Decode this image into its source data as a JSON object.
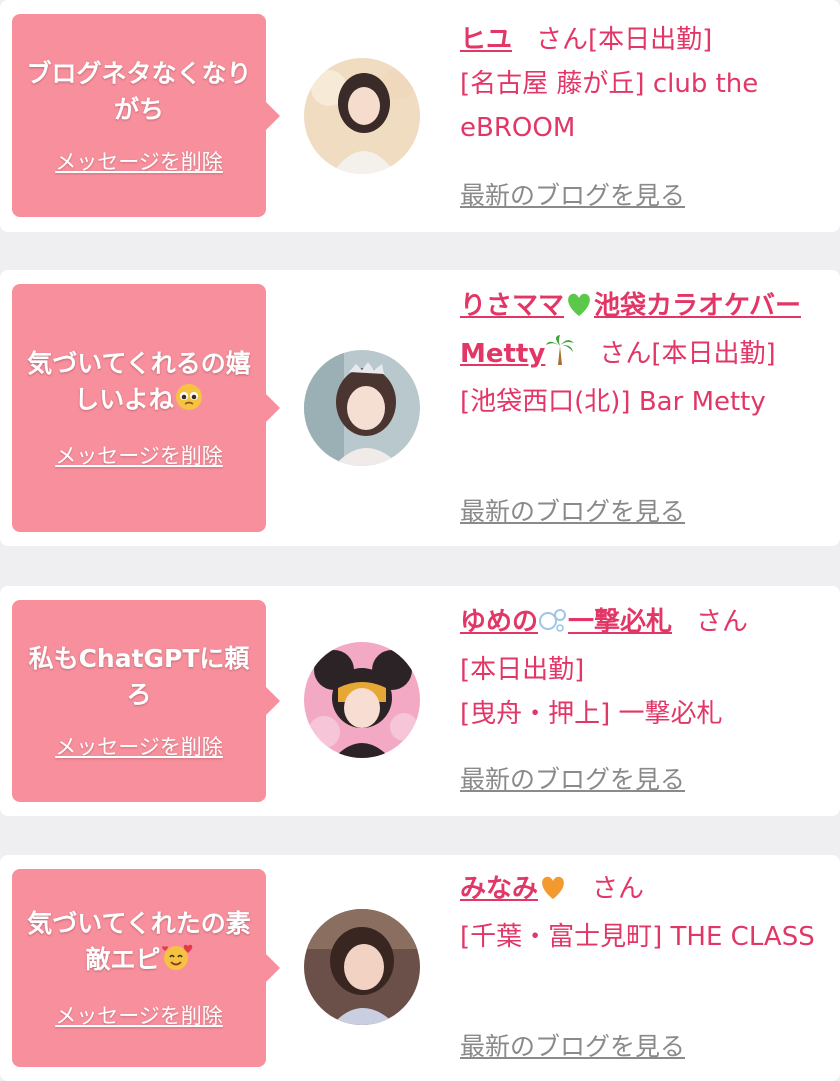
{
  "colors": {
    "accent": "#e23766",
    "bubble": "#f88f9c",
    "link_gray": "#8a8a8a"
  },
  "cards": [
    {
      "message": "ブログネタなくなりがち",
      "delete_label": "メッセージを削除",
      "name": "ヒユ",
      "suffix": "さん",
      "status": "[本日出勤]",
      "location": "[名古屋 藤が丘] club the eBROOM",
      "blog_link": "最新のブログを見る"
    },
    {
      "message": "気づいてくれるの嬉しいよね",
      "message_emoji": "pleading-face-emoji",
      "delete_label": "メッセージを削除",
      "name_part1": "りさママ",
      "name_emoji1": "green-heart-emoji",
      "name_part2": "池袋カラオケバーMetty",
      "name_emoji2": "palm-tree-emoji",
      "suffix": "さん",
      "status": "[本日出勤]",
      "location": "[池袋西口(北)] Bar Metty",
      "blog_link": "最新のブログを見る"
    },
    {
      "message": "私もChatGPTに頼ろ",
      "delete_label": "メッセージを削除",
      "name_part1": "ゆめの",
      "name_emoji1": "bubbles-emoji",
      "name_part2": "一撃必札",
      "suffix": "さん",
      "status": "[本日出勤]",
      "location": "[曳舟・押上] 一撃必札",
      "blog_link": "最新のブログを見る"
    },
    {
      "message": "気づいてくれたの素敵エピ",
      "message_emoji": "smiling-face-with-hearts-emoji",
      "delete_label": "メッセージを削除",
      "name_part1": "みなみ",
      "name_emoji1": "orange-heart-emoji",
      "suffix": "さん",
      "location": "[千葉・富士見町] THE CLASS",
      "blog_link": "最新のブログを見る"
    }
  ]
}
